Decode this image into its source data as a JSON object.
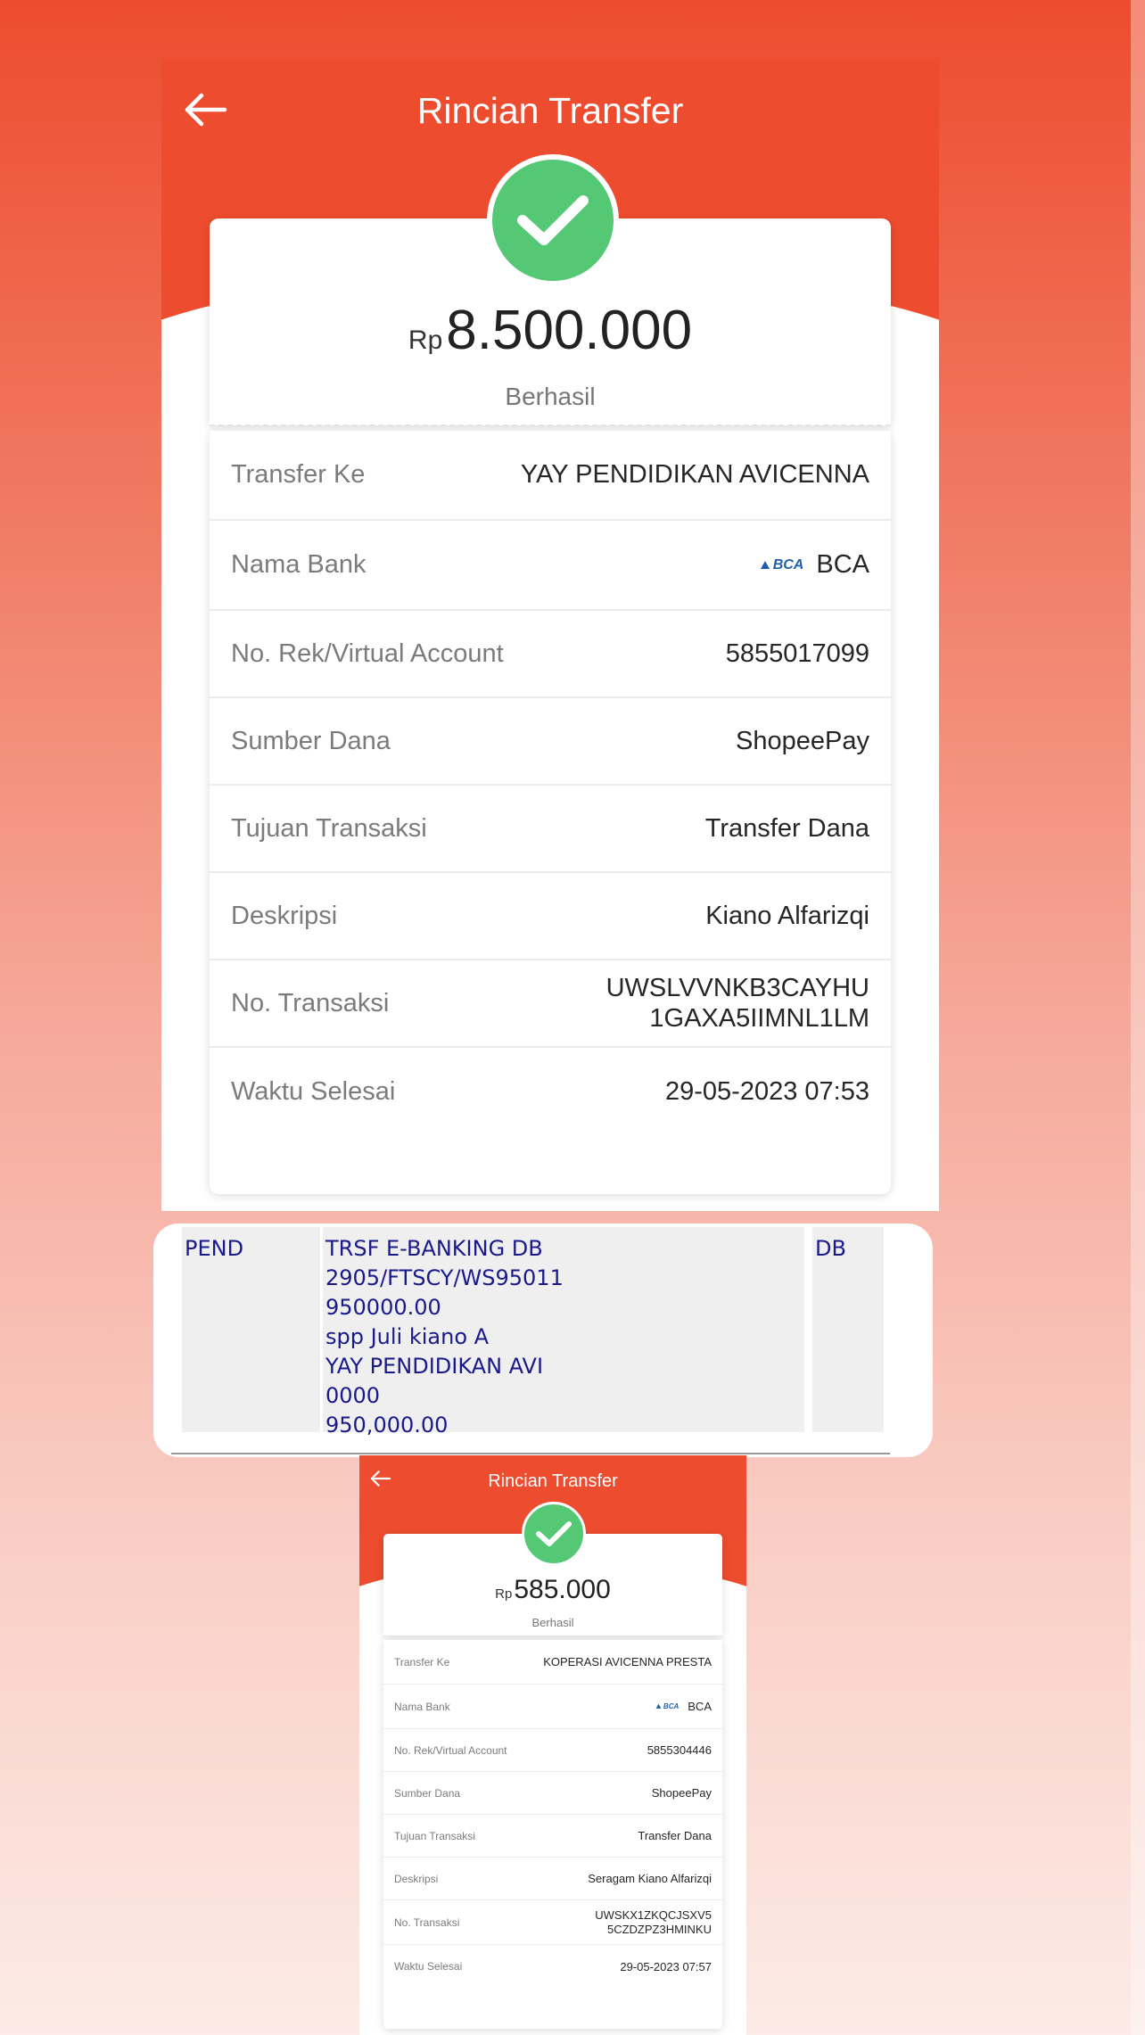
{
  "receipt_main": {
    "title": "Rincian Transfer",
    "currency": "Rp",
    "amount": "8.500.000",
    "status": "Berhasil",
    "rows": [
      {
        "label": "Transfer Ke",
        "value": "YAY PENDIDIKAN AVICENNA"
      },
      {
        "label": "Nama Bank",
        "value": "BCA",
        "logo_text": "BCA"
      },
      {
        "label": "No. Rek/Virtual Account",
        "value": "5855017099"
      },
      {
        "label": "Sumber Dana",
        "value": "ShopeePay"
      },
      {
        "label": "Tujuan Transaksi",
        "value": "Transfer Dana"
      },
      {
        "label": "Deskripsi",
        "value": "Kiano Alfarizqi"
      },
      {
        "label": "No. Transaksi",
        "value_line1": "UWSLVVNKB3CAYHU",
        "value_line2": "1GAXA5IIMNL1LM"
      },
      {
        "label": "Waktu Selesai",
        "value": "29-05-2023 07:53"
      }
    ]
  },
  "statement": {
    "col1": "PEND",
    "col2_lines": [
      "TRSF E-BANKING DB",
      "2905/FTSCY/WS95011",
      "950000.00",
      "spp Juli kiano A",
      "YAY PENDIDIKAN AVI",
      "0000",
      "950,000.00"
    ],
    "col3": "DB"
  },
  "receipt_small": {
    "title": "Rincian Transfer",
    "currency": "Rp",
    "amount": "585.000",
    "status": "Berhasil",
    "rows": [
      {
        "label": "Transfer Ke",
        "value": "KOPERASI AVICENNA PRESTA"
      },
      {
        "label": "Nama Bank",
        "value": "BCA",
        "logo_text": "BCA"
      },
      {
        "label": "No. Rek/Virtual Account",
        "value": "5855304446"
      },
      {
        "label": "Sumber Dana",
        "value": "ShopeePay"
      },
      {
        "label": "Tujuan Transaksi",
        "value": "Transfer Dana"
      },
      {
        "label": "Deskripsi",
        "value": "Seragam Kiano Alfarizqi"
      },
      {
        "label": "No. Transaksi",
        "value_line1": "UWSKX1ZKQCJSXV5",
        "value_line2": "5CZDZPZ3HMINKU"
      },
      {
        "label": "Waktu Selesai",
        "value": "29-05-2023 07:57"
      }
    ]
  },
  "colors": {
    "brand": "#ee4c2e",
    "success": "#54c875",
    "statement_text": "#1a1a8a"
  },
  "icons": [
    "back-arrow-icon",
    "success-check-icon",
    "bca-logo-icon"
  ]
}
